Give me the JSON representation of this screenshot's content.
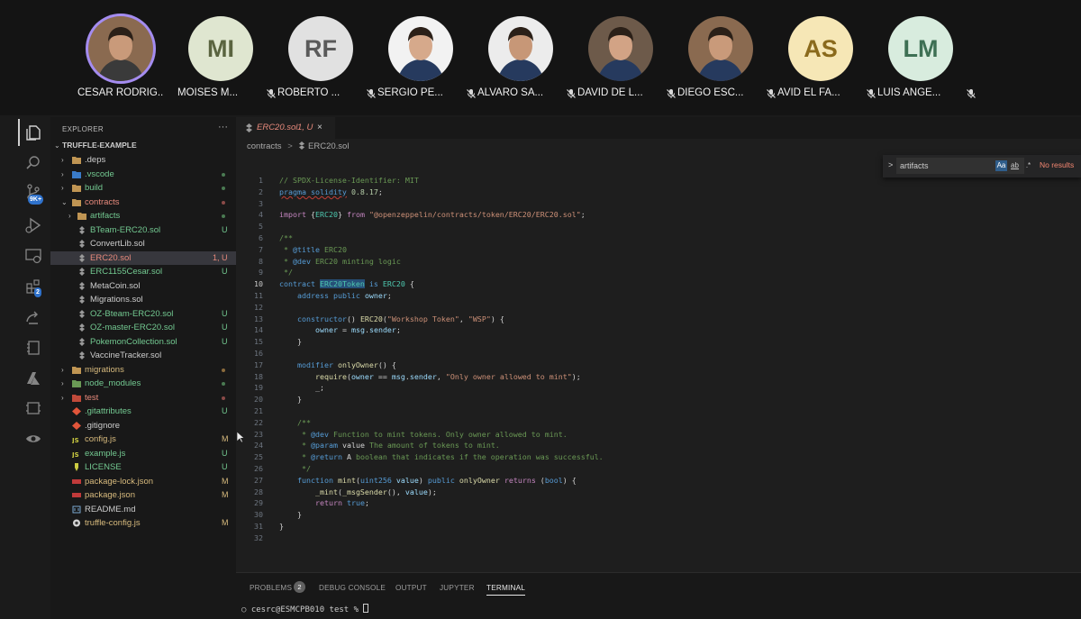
{
  "participants": [
    {
      "name": "CESAR RODRIG...",
      "initials": "",
      "avatar": "photo",
      "active": true,
      "muted": false
    },
    {
      "name": "MOISES M...",
      "initials": "MI",
      "avatar": "initials",
      "color": "#dfe6d0",
      "text_color": "#5a6440",
      "muted": true
    },
    {
      "name": "ROBERTO ...",
      "initials": "RF",
      "avatar": "initials",
      "color": "#e1e1e1",
      "text_color": "#5a5a5a",
      "muted": true
    },
    {
      "name": "SERGIO PE...",
      "initials": "",
      "avatar": "photo",
      "muted": true
    },
    {
      "name": "ALVARO SA...",
      "initials": "",
      "avatar": "photo",
      "muted": true
    },
    {
      "name": "DAVID DE L...",
      "initials": "",
      "avatar": "photo",
      "muted": true
    },
    {
      "name": "DIEGO ESC...",
      "initials": "",
      "avatar": "photo",
      "muted": true
    },
    {
      "name": "AVID EL FA...",
      "initials": "AS",
      "avatar": "initials",
      "color": "#f6e7b6",
      "text_color": "#8a6a1c",
      "muted": true
    },
    {
      "name": "LUIS ANGE...",
      "initials": "LM",
      "avatar": "initials",
      "color": "#d8ecde",
      "text_color": "#3e7054",
      "muted": true
    }
  ],
  "activity_bar": {
    "icons": [
      "files-icon",
      "search-icon",
      "source-control-icon",
      "run-debug-icon",
      "remote-explorer-icon",
      "extensions-icon",
      "live-share-icon",
      "notebook-icon",
      "azure-icon",
      "container-icon",
      "ethereum-icon"
    ],
    "badges": {
      "source_control": "9K+",
      "extensions": "2"
    }
  },
  "explorer": {
    "title": "EXPLORER",
    "more": "···",
    "root": "TRUFFLE-EXAMPLE",
    "items": [
      {
        "label": ".deps",
        "kind": "folder",
        "depth": 1,
        "color": "#cccccc",
        "status": ""
      },
      {
        "label": ".vscode",
        "kind": "folder-vscode",
        "depth": 1,
        "color": "#73c991",
        "status": "dot-green"
      },
      {
        "label": "build",
        "kind": "folder",
        "depth": 1,
        "color": "#73c991",
        "status": "dot-green"
      },
      {
        "label": "contracts",
        "kind": "folder-open",
        "depth": 1,
        "color": "#e88a7c",
        "status": "dot-red"
      },
      {
        "label": "artifacts",
        "kind": "folder",
        "depth": 2,
        "color": "#73c991",
        "status": "dot-green"
      },
      {
        "label": "BTeam-ERC20.sol",
        "kind": "sol",
        "depth": 2,
        "color": "#73c991",
        "status": "U"
      },
      {
        "label": "ConvertLib.sol",
        "kind": "sol",
        "depth": 2,
        "color": "#cccccc",
        "status": ""
      },
      {
        "label": "ERC20.sol",
        "kind": "sol",
        "depth": 2,
        "color": "#e88a7c",
        "status": "1, U",
        "selected": true
      },
      {
        "label": "ERC1155Cesar.sol",
        "kind": "sol",
        "depth": 2,
        "color": "#73c991",
        "status": "U"
      },
      {
        "label": "MetaCoin.sol",
        "kind": "sol",
        "depth": 2,
        "color": "#cccccc",
        "status": ""
      },
      {
        "label": "Migrations.sol",
        "kind": "sol",
        "depth": 2,
        "color": "#cccccc",
        "status": ""
      },
      {
        "label": "OZ-Bteam-ERC20.sol",
        "kind": "sol",
        "depth": 2,
        "color": "#73c991",
        "status": "U"
      },
      {
        "label": "OZ-master-ERC20.sol",
        "kind": "sol",
        "depth": 2,
        "color": "#73c991",
        "status": "U"
      },
      {
        "label": "PokemonCollection.sol",
        "kind": "sol",
        "depth": 2,
        "color": "#73c991",
        "status": "U"
      },
      {
        "label": "VaccineTracker.sol",
        "kind": "sol",
        "depth": 2,
        "color": "#cccccc",
        "status": ""
      },
      {
        "label": "migrations",
        "kind": "folder",
        "depth": 1,
        "color": "#d7ba7d",
        "status": "dot-orange"
      },
      {
        "label": "node_modules",
        "kind": "folder-node",
        "depth": 1,
        "color": "#73c991",
        "status": "dot-green"
      },
      {
        "label": "test",
        "kind": "folder-test",
        "depth": 1,
        "color": "#e88a7c",
        "status": "dot-red"
      },
      {
        "label": ".gitattributes",
        "kind": "git",
        "depth": 1,
        "color": "#73c991",
        "status": "U"
      },
      {
        "label": ".gitignore",
        "kind": "git",
        "depth": 1,
        "color": "#cccccc",
        "status": ""
      },
      {
        "label": "config.js",
        "kind": "js",
        "depth": 1,
        "color": "#d7ba7d",
        "status": "M"
      },
      {
        "label": "example.js",
        "kind": "js",
        "depth": 1,
        "color": "#73c991",
        "status": "U"
      },
      {
        "label": "LICENSE",
        "kind": "license",
        "depth": 1,
        "color": "#73c991",
        "status": "U"
      },
      {
        "label": "package-lock.json",
        "kind": "npm",
        "depth": 1,
        "color": "#d7ba7d",
        "status": "M"
      },
      {
        "label": "package.json",
        "kind": "npm",
        "depth": 1,
        "color": "#d7ba7d",
        "status": "M"
      },
      {
        "label": "README.md",
        "kind": "md",
        "depth": 1,
        "color": "#cccccc",
        "status": ""
      },
      {
        "label": "truffle-config.js",
        "kind": "truffle",
        "depth": 1,
        "color": "#d7ba7d",
        "status": "M"
      }
    ]
  },
  "editor": {
    "tab": {
      "label": "ERC20.sol",
      "state": "1, U",
      "close": "×"
    },
    "breadcrumb": {
      "folder": "contracts",
      "separator": ">",
      "file": "ERC20.sol"
    },
    "current_line": 10,
    "lines": [
      [
        [
          "c-com",
          "// SPDX-License-Identifier: MIT"
        ]
      ],
      [
        [
          "c-kw wavy",
          "pragma solidity"
        ],
        [
          "",
          " "
        ],
        [
          "c-num",
          "0.8.17"
        ],
        [
          "",
          ";"
        ]
      ],
      [],
      [
        [
          "c-ctl",
          "import"
        ],
        [
          "",
          " {"
        ],
        [
          "c-typ",
          "ERC20"
        ],
        [
          "",
          "} "
        ],
        [
          "c-ctl",
          "from"
        ],
        [
          "",
          " "
        ],
        [
          "c-str",
          "\"@openzeppelin/contracts/token/ERC20/ERC20.sol\""
        ],
        [
          "",
          ";"
        ]
      ],
      [],
      [
        [
          "c-com",
          "/**"
        ]
      ],
      [
        [
          "c-com",
          " * "
        ],
        [
          "c-tag",
          "@title"
        ],
        [
          "c-com",
          " ERC20"
        ]
      ],
      [
        [
          "c-com",
          " * "
        ],
        [
          "c-tag",
          "@dev"
        ],
        [
          "c-com",
          " ERC20 minting logic"
        ]
      ],
      [
        [
          "c-com",
          " */"
        ]
      ],
      [
        [
          "c-kw",
          "contract"
        ],
        [
          "",
          " "
        ],
        [
          "c-typ c-hl",
          "ERC20Token"
        ],
        [
          "",
          " "
        ],
        [
          "c-kw",
          "is"
        ],
        [
          "",
          " "
        ],
        [
          "c-typ",
          "ERC20"
        ],
        [
          "",
          " {"
        ]
      ],
      [
        [
          "",
          "    "
        ],
        [
          "c-kw",
          "address"
        ],
        [
          "",
          " "
        ],
        [
          "c-kw",
          "public"
        ],
        [
          "",
          " "
        ],
        [
          "c-var",
          "owner"
        ],
        [
          "",
          ";"
        ]
      ],
      [],
      [
        [
          "",
          "    "
        ],
        [
          "c-kw",
          "constructor"
        ],
        [
          "",
          "() "
        ],
        [
          "c-fn",
          "ERC20"
        ],
        [
          "",
          "("
        ],
        [
          "c-str",
          "\"Workshop Token\""
        ],
        [
          "",
          ", "
        ],
        [
          "c-str",
          "\"WSP\""
        ],
        [
          "",
          ") {"
        ]
      ],
      [
        [
          "",
          "        "
        ],
        [
          "c-var",
          "owner"
        ],
        [
          "",
          " = "
        ],
        [
          "c-var",
          "msg"
        ],
        [
          "",
          "."
        ],
        [
          "c-var",
          "sender"
        ],
        [
          "",
          ";"
        ]
      ],
      [
        [
          "",
          "    }"
        ]
      ],
      [],
      [
        [
          "",
          "    "
        ],
        [
          "c-kw",
          "modifier"
        ],
        [
          "",
          " "
        ],
        [
          "c-fn",
          "onlyOwner"
        ],
        [
          "",
          "() {"
        ]
      ],
      [
        [
          "",
          "        "
        ],
        [
          "c-fn",
          "require"
        ],
        [
          "",
          "("
        ],
        [
          "c-var",
          "owner"
        ],
        [
          "",
          " == "
        ],
        [
          "c-var",
          "msg"
        ],
        [
          "",
          "."
        ],
        [
          "c-var",
          "sender"
        ],
        [
          "",
          ", "
        ],
        [
          "c-str",
          "\"Only owner allowed to mint\""
        ],
        [
          "",
          ");"
        ]
      ],
      [
        [
          "",
          "        _;"
        ]
      ],
      [
        [
          "",
          "    }"
        ]
      ],
      [],
      [
        [
          "",
          "    "
        ],
        [
          "c-com",
          "/**"
        ]
      ],
      [
        [
          "",
          "    "
        ],
        [
          "c-com",
          " * "
        ],
        [
          "c-tag",
          "@dev"
        ],
        [
          "c-com",
          " Function to mint tokens. Only owner allowed to mint."
        ]
      ],
      [
        [
          "",
          "    "
        ],
        [
          "c-com",
          " * "
        ],
        [
          "c-tag",
          "@param"
        ],
        [
          "c-com",
          " "
        ],
        [
          "",
          "value"
        ],
        [
          "c-com",
          " The amount of tokens to mint."
        ]
      ],
      [
        [
          "",
          "    "
        ],
        [
          "c-com",
          " * "
        ],
        [
          "c-tag",
          "@return"
        ],
        [
          "c-com",
          " "
        ],
        [
          "",
          "A"
        ],
        [
          "c-com",
          " boolean that indicates if the operation was successful."
        ]
      ],
      [
        [
          "",
          "    "
        ],
        [
          "c-com",
          " */"
        ]
      ],
      [
        [
          "",
          "    "
        ],
        [
          "c-kw",
          "function"
        ],
        [
          "",
          " "
        ],
        [
          "c-fn",
          "mint"
        ],
        [
          "",
          "("
        ],
        [
          "c-kw",
          "uint256"
        ],
        [
          "",
          " "
        ],
        [
          "c-var",
          "value"
        ],
        [
          "",
          ") "
        ],
        [
          "c-kw",
          "public"
        ],
        [
          "",
          " "
        ],
        [
          "c-fn",
          "onlyOwner"
        ],
        [
          "",
          " "
        ],
        [
          "c-ctl",
          "returns"
        ],
        [
          "",
          " ("
        ],
        [
          "c-kw",
          "bool"
        ],
        [
          "",
          ") {"
        ]
      ],
      [
        [
          "",
          "        "
        ],
        [
          "c-fn",
          "_mint"
        ],
        [
          "",
          "("
        ],
        [
          "c-fn",
          "_msgSender"
        ],
        [
          "",
          "(), "
        ],
        [
          "c-var",
          "value"
        ],
        [
          "",
          ");"
        ]
      ],
      [
        [
          "",
          "        "
        ],
        [
          "c-ctl",
          "return"
        ],
        [
          "",
          " "
        ],
        [
          "c-kw",
          "true"
        ],
        [
          "",
          ";"
        ]
      ],
      [
        [
          "",
          "    }"
        ]
      ],
      [
        [
          "",
          "}"
        ]
      ],
      []
    ],
    "find": {
      "chevron": ">",
      "query": "artifacts",
      "opt_case": "Aa",
      "opt_word": "ab",
      "opt_regex": ".*",
      "result": "No results"
    }
  },
  "panel": {
    "tabs": [
      {
        "label": "PROBLEMS",
        "badge": "2"
      },
      {
        "label": "DEBUG CONSOLE"
      },
      {
        "label": "OUTPUT"
      },
      {
        "label": "JUPYTER"
      },
      {
        "label": "TERMINAL",
        "active": true
      }
    ],
    "terminal_prompt": "○ cesrc@ESMCPB010 test % "
  }
}
